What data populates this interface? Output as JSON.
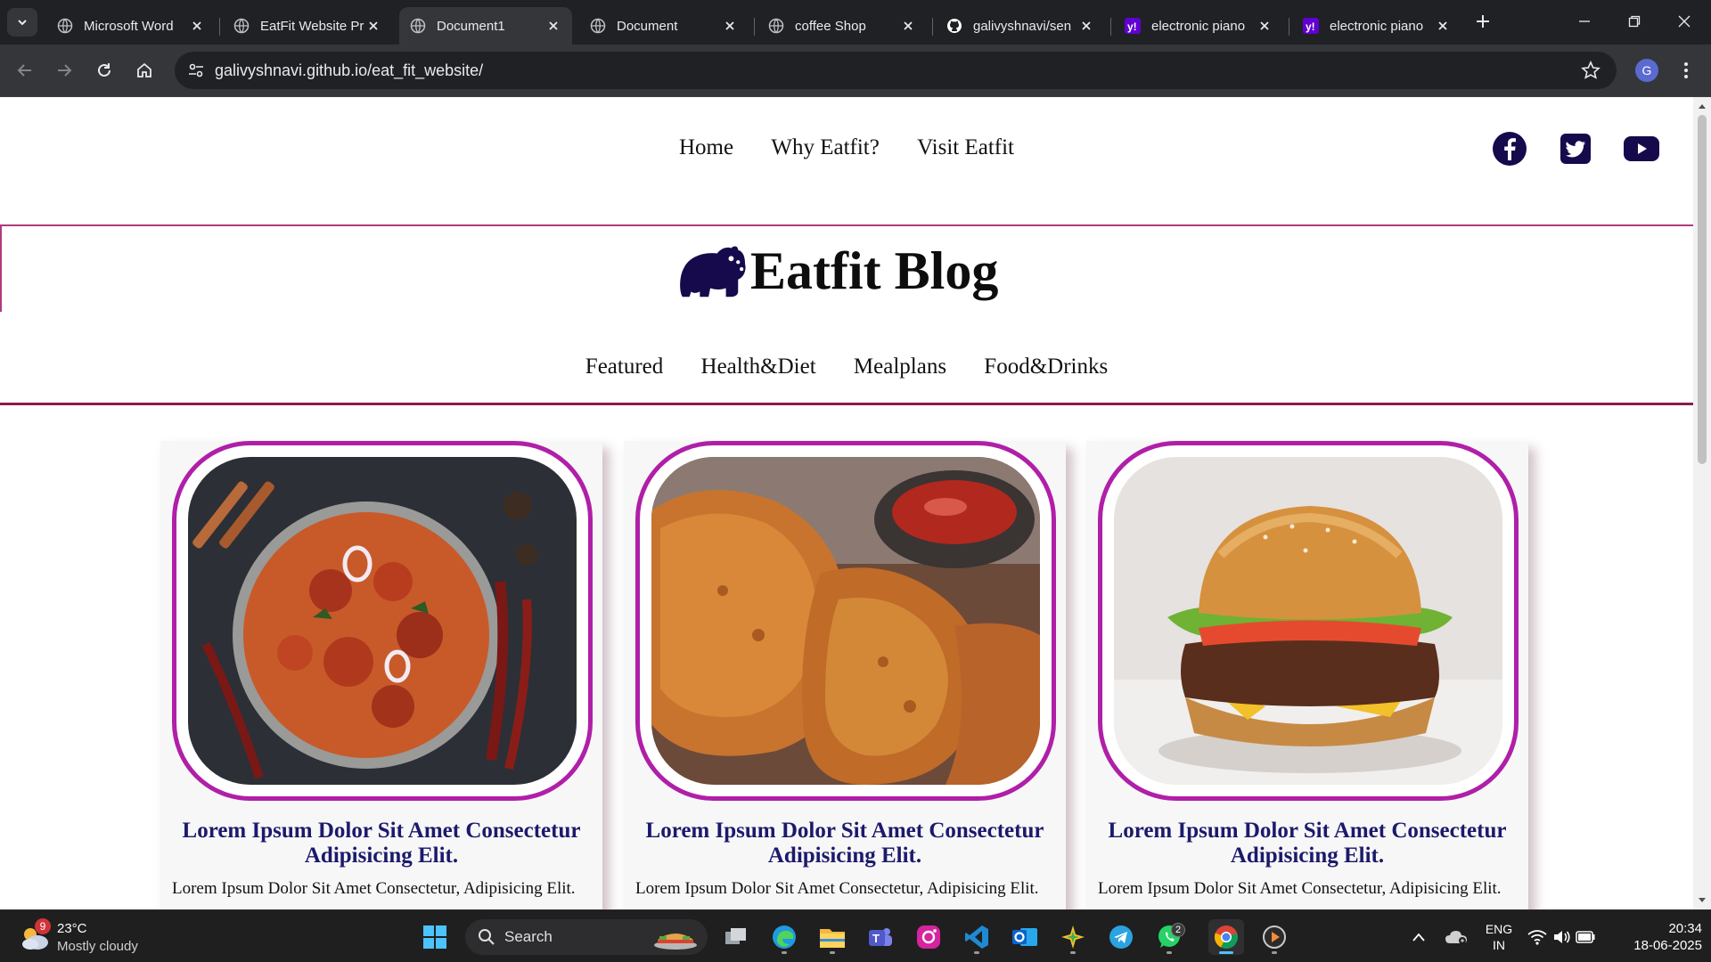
{
  "browser": {
    "tabs": [
      {
        "title": "Microsoft Word",
        "icon": "globe-icon",
        "active": false
      },
      {
        "title": "EatFit Website Pr",
        "icon": "globe-icon",
        "active": false
      },
      {
        "title": "Document1",
        "icon": "globe-icon",
        "active": true
      },
      {
        "title": "Document",
        "icon": "globe-icon",
        "active": false
      },
      {
        "title": "coffee Shop",
        "icon": "globe-icon",
        "active": false
      },
      {
        "title": "galivyshnavi/sen",
        "icon": "github-icon",
        "active": false
      },
      {
        "title": "electronic piano",
        "icon": "yahoo-icon",
        "active": false
      },
      {
        "title": "electronic piano",
        "icon": "yahoo-icon",
        "active": false
      }
    ],
    "url": "galivyshnavi.github.io/eat_fit_website/",
    "profile_initial": "G"
  },
  "site": {
    "nav": [
      "Home",
      "Why Eatfit?",
      "Visit Eatfit"
    ],
    "social": [
      "facebook-icon",
      "twitter-icon",
      "youtube-icon"
    ],
    "blog_title": "Eatfit Blog",
    "categories": [
      "Featured",
      "Health&Diet",
      "Mealplans",
      "Food&Drinks"
    ],
    "cards": [
      {
        "image": "chicken-curry-image",
        "title": "Lorem Ipsum Dolor Sit Amet Consectetur Adipisicing Elit.",
        "text": "Lorem Ipsum Dolor Sit Amet Consectetur, Adipisicing Elit."
      },
      {
        "image": "fried-chicken-image",
        "title": "Lorem Ipsum Dolor Sit Amet Consectetur Adipisicing Elit.",
        "text": "Lorem Ipsum Dolor Sit Amet Consectetur, Adipisicing Elit."
      },
      {
        "image": "burger-image",
        "title": "Lorem Ipsum Dolor Sit Amet Consectetur Adipisicing Elit.",
        "text": "Lorem Ipsum Dolor Sit Amet Consectetur, Adipisicing Elit."
      }
    ],
    "colors": {
      "accent_border": "#b01fa8",
      "header_line": "#8c1b4d",
      "card_title": "#1c1a6b"
    }
  },
  "taskbar": {
    "weather": {
      "temp": "23°C",
      "condition": "Mostly cloudy",
      "badge": "9"
    },
    "search_label": "Search",
    "whatsapp_badge": "2",
    "language": {
      "line1": "ENG",
      "line2": "IN"
    },
    "time": "20:34",
    "date": "18-06-2025"
  }
}
